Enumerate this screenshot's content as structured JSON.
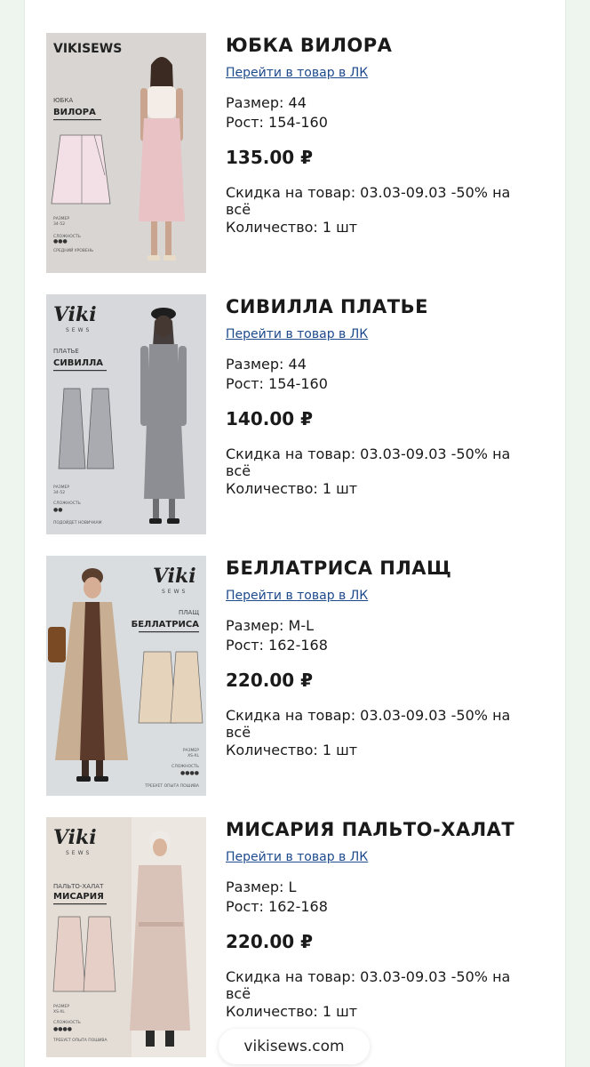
{
  "products": [
    {
      "title": "ЮБКА ВИЛОРА",
      "link": "Перейти в товар в ЛК",
      "size": "Размер: 44",
      "height": "Рост: 154-160",
      "price": "135.00 ₽",
      "discount": "Скидка на товар: 03.03-09.03 -50% на всё",
      "quantity": "Количество: 1 шт",
      "image": {
        "brand": "VIKISEWS",
        "kind": "ЮБКА",
        "name": "ВИЛОРА",
        "label_size": "РАЗМЕР",
        "size_range": "34-52",
        "label_complexity": "СЛОЖНОСТЬ",
        "level": "СРЕДНИЙ УРОВЕНЬ"
      }
    },
    {
      "title": "СИВИЛЛА ПЛАТЬЕ",
      "link": "Перейти в товар в ЛК",
      "size": "Размер: 44",
      "height": "Рост: 154-160",
      "price": "140.00 ₽",
      "discount": "Скидка на товар: 03.03-09.03 -50% на всё",
      "quantity": "Количество: 1 шт",
      "image": {
        "brand": "Viki",
        "brand_sub": "SEWS",
        "kind": "ПЛАТЬЕ",
        "name": "СИВИЛЛА",
        "label_size": "РАЗМЕР",
        "size_range": "34-52",
        "label_complexity": "СЛОЖНОСТЬ",
        "level": "ПОДОЙДЕТ НОВИЧКАМ"
      }
    },
    {
      "title": "БЕЛЛАТРИСА ПЛАЩ",
      "link": "Перейти в товар в ЛК",
      "size": "Размер: M-L",
      "height": "Рост: 162-168",
      "price": "220.00 ₽",
      "discount": "Скидка на товар: 03.03-09.03 -50% на всё",
      "quantity": "Количество: 1 шт",
      "image": {
        "brand": "Viki",
        "brand_sub": "SEWS",
        "kind": "ПЛАЩ",
        "name": "БЕЛЛАТРИСА",
        "label_size": "РАЗМЕР",
        "size_range": "XS-XL",
        "label_complexity": "СЛОЖНОСТЬ",
        "level": "ТРЕБУЕТ ОПЫТА ПОШИВА"
      }
    },
    {
      "title": "МИСАРИЯ ПАЛЬТО-ХАЛАТ",
      "link": "Перейти в товар в ЛК",
      "size": "Размер: L",
      "height": "Рост: 162-168",
      "price": "220.00 ₽",
      "discount": "Скидка на товар: 03.03-09.03 -50% на всё",
      "quantity": "Количество: 1 шт",
      "image": {
        "brand": "Viki",
        "brand_sub": "SEWS",
        "kind": "ПАЛЬТО-ХАЛАТ",
        "name": "МИСАРИЯ",
        "label_size": "РАЗМЕР",
        "size_range": "XS-XL",
        "label_complexity": "СЛОЖНОСТЬ",
        "level": "ТРЕБУЕТ ОПЫТА ПОШИВА"
      }
    }
  ],
  "footer": {
    "url": "vikisews.com"
  }
}
